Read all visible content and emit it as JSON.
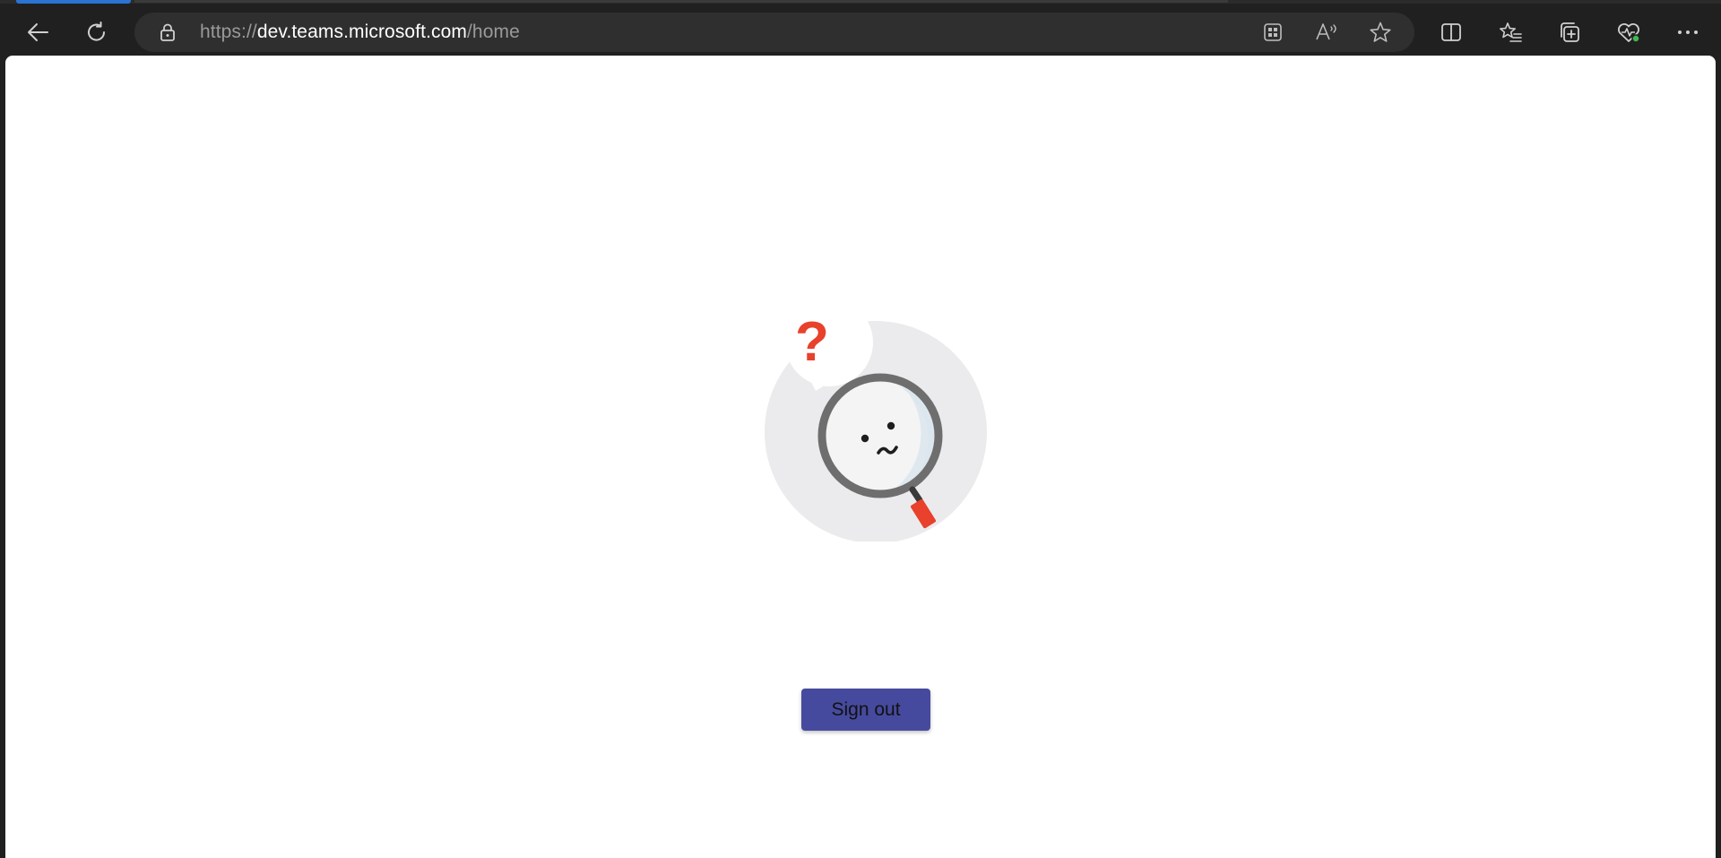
{
  "browser": {
    "address_bar": {
      "scheme": "https://",
      "host": "dev.teams.microsoft.com",
      "path": "/home"
    },
    "colors": {
      "chrome_bg": "#202020",
      "address_bg": "#2f2f2f",
      "active_tab_accent": "#2a74d4",
      "health_status_dot": "#3fb950"
    },
    "toolbar_icons": [
      "back-arrow-icon",
      "refresh-icon",
      "lock-icon",
      "app-available-icon",
      "read-aloud-icon",
      "favorite-star-icon",
      "split-screen-icon",
      "favorites-list-icon",
      "collections-icon",
      "browser-essentials-icon",
      "more-options-icon"
    ]
  },
  "page": {
    "illustration": {
      "icon": "magnifier-question-icon",
      "question_mark": "?",
      "colors": {
        "circle": "#ebebed",
        "question": "#e8412c",
        "handle": "#e8412c",
        "ring": "#6e6e6e"
      }
    },
    "sign_out_button": {
      "label": "Sign out",
      "background": "#464a9e"
    }
  }
}
